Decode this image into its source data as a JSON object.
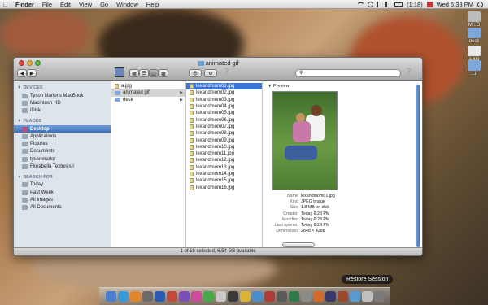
{
  "menubar": {
    "items": [
      "Finder",
      "File",
      "Edit",
      "View",
      "Go",
      "Window",
      "Help"
    ],
    "battery": "(1:18)",
    "clock": "Wed 6:33 PM"
  },
  "desktop_icons": [
    {
      "label": "M...D"
    },
    {
      "label": "desk"
    },
    {
      "label": "a.jpg"
    },
    {
      "label": "...if"
    }
  ],
  "window": {
    "title": "animated gif",
    "search_placeholder": "",
    "status": "1 of 16 selected, 6.54 GB available"
  },
  "sidebar": {
    "devices_label": "DEVICES",
    "devices": [
      "Tyson Marlor's MacBook",
      "Macintosh HD",
      "iDisk"
    ],
    "places_label": "PLACES",
    "places": [
      "Desktop",
      "Applications",
      "Pictures",
      "Documents",
      "tysonmarlor",
      "Florabella Textures I"
    ],
    "search_label": "SEARCH FOR",
    "searches": [
      "Today",
      "Past Week",
      "All Images",
      "All Documents"
    ]
  },
  "col1": [
    "a.jpg",
    "animated gif",
    "desk"
  ],
  "col2": [
    "lexandmom01.jpg",
    "lexandmom02.jpg",
    "lexandmom03.jpg",
    "lexandmom04.jpg",
    "lexandmom05.jpg",
    "lexandmom06.jpg",
    "lexandmom07.jpg",
    "lexandmom08.jpg",
    "lexandmom09.jpg",
    "lexandmom10.jpg",
    "lexandmom11.jpg",
    "lexandmom12.jpg",
    "lexandmom13.jpg",
    "lexandmom14.jpg",
    "lexandmom15.jpg",
    "lexandmom16.jpg"
  ],
  "preview": {
    "label": "Preview:",
    "meta": [
      {
        "k": "Name",
        "v": "lexandmom01.jpg"
      },
      {
        "k": "Kind",
        "v": "JPEG image"
      },
      {
        "k": "Size",
        "v": "1.8 MB on disk"
      },
      {
        "k": "Created",
        "v": "Today 6:28 PM"
      },
      {
        "k": "Modified",
        "v": "Today 6:28 PM"
      },
      {
        "k": "Last opened",
        "v": "Today 6:29 PM"
      },
      {
        "k": "Dimensions",
        "v": "2848 × 4288"
      }
    ]
  },
  "restore_session": "Restore Session"
}
